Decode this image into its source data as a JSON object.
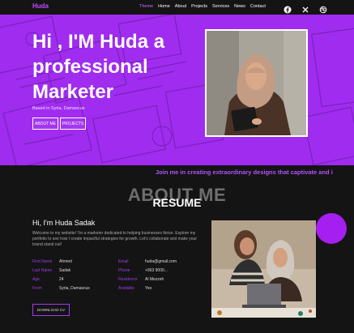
{
  "nav": {
    "logo": "Huda",
    "links": [
      "Theme",
      "Home",
      "About",
      "Projects",
      "Services",
      "News",
      "Contact"
    ],
    "active_index": 0,
    "socials": [
      "facebook-icon",
      "x-twitter-icon",
      "dribbble-icon"
    ]
  },
  "hero": {
    "title": "Hi , I'M Huda a professional Marketer",
    "based": "Based in Syria, Damascus",
    "btn_about": "ABOUT ME",
    "btn_projects": "PROJECTS"
  },
  "marquee": "Join me in creating extraordinary designs that captivate and i",
  "about": {
    "big_title": "ABOUT ME",
    "sub_title": "RESUME",
    "hi": "Hi, I'm Huda Sadak",
    "desc": "Welcome to my website! I'm a marketer dedicated to helping businesses thrive. Explore my portfolio to see how I create impactful strategies for growth. Let's collaborate and make your brand stand out!",
    "left_info": [
      {
        "k": "First Name",
        "v": "Ahmed"
      },
      {
        "k": "Last Name",
        "v": "Sadak"
      },
      {
        "k": "Age",
        "v": "24"
      },
      {
        "k": "From",
        "v": "Syria, Damascus"
      }
    ],
    "right_info": [
      {
        "k": "Email",
        "v": "huda@gmail.com"
      },
      {
        "k": "Phone",
        "v": "+963 9000..."
      },
      {
        "k": "Residence",
        "v": "Al Mezzeh"
      },
      {
        "k": "Available",
        "v": "Yes"
      }
    ],
    "cv_button": "DOWNLOAD CV"
  },
  "colors": {
    "accent": "#a02cf0",
    "background": "#141414",
    "label": "#a03aec"
  }
}
